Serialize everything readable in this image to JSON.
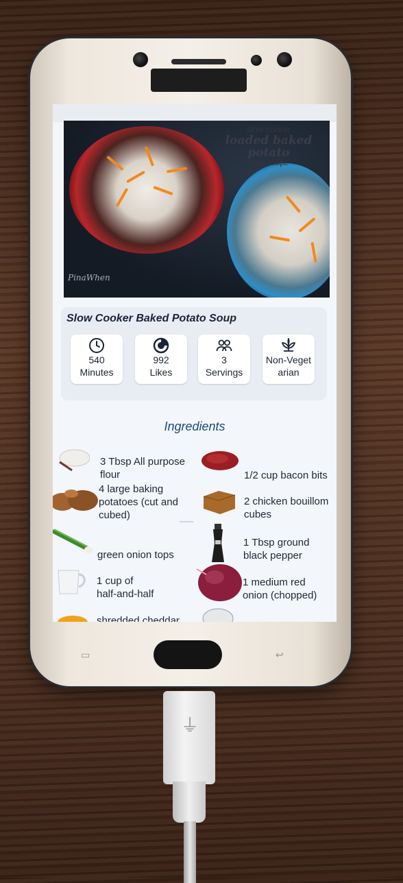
{
  "hero": {
    "line1": "slow cooker",
    "line2": "loaded baked potato",
    "line3": "soup recipe",
    "watermark": "PinaWhen"
  },
  "recipe": {
    "title": "Slow Cooker Baked Potato Soup",
    "stats": [
      {
        "icon": "clock-icon",
        "value": "540",
        "label": "Minutes"
      },
      {
        "icon": "likes-icon",
        "value": "992",
        "label": "Likes"
      },
      {
        "icon": "people-icon",
        "value": "3",
        "label": "Servings"
      },
      {
        "icon": "leaf-icon",
        "value": "Non-Veget",
        "label": "arian"
      }
    ]
  },
  "ingredients_heading": "Ingredients",
  "ingredients": [
    {
      "icon": "flour-icon",
      "text_a": "3 Tbsp All purpose",
      "text_b": "flour"
    },
    {
      "icon": "bacon-bits-icon",
      "text_a": "1/2 cup bacon bits",
      "text_b": ""
    },
    {
      "icon": "potatoes-icon",
      "text_a": "4 large baking",
      "text_b": "potatoes (cut and",
      "text_c": "cubed)"
    },
    {
      "icon": "bouillon-icon",
      "text_a": "2 chicken bouillom",
      "text_b": "cubes"
    },
    {
      "icon": "green-onion-icon",
      "text_a": "green onion tops",
      "text_b": ""
    },
    {
      "icon": "pepper-grinder-icon",
      "text_a": "1 Tbsp ground",
      "text_b": "black pepper"
    },
    {
      "icon": "milk-jug-icon",
      "text_a": "1 cup of",
      "text_b": "half-and-half"
    },
    {
      "icon": "red-onion-icon",
      "text_a": "1 medium red",
      "text_b": "onion (chopped)"
    },
    {
      "icon": "cheese-icon",
      "text_a": "shredded cheddar",
      "text_b": ""
    }
  ]
}
